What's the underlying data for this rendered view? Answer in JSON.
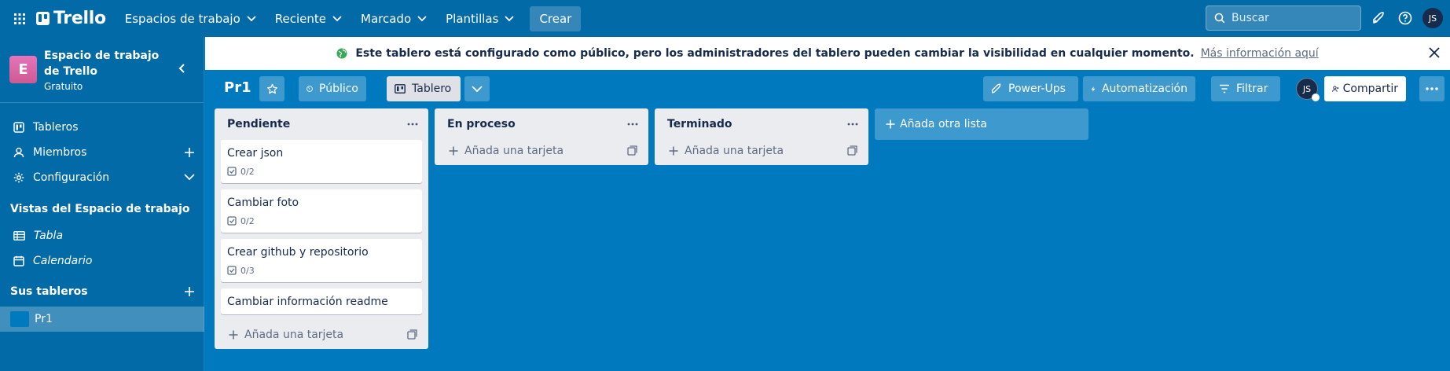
{
  "topnav": {
    "logo": "Trello",
    "menus": [
      {
        "label": "Espacios de trabajo"
      },
      {
        "label": "Reciente"
      },
      {
        "label": "Marcado"
      },
      {
        "label": "Plantillas"
      }
    ],
    "create": "Crear",
    "search_placeholder": "Buscar",
    "user_initials": "JS"
  },
  "sidebar": {
    "workspace_initial": "E",
    "workspace_name": "Espacio de trabajo de Trello",
    "workspace_plan": "Gratuito",
    "items": [
      {
        "label": "Tableros"
      },
      {
        "label": "Miembros"
      },
      {
        "label": "Configuración"
      }
    ],
    "views_title": "Vistas del Espacio de trabajo",
    "views": [
      {
        "label": "Tabla"
      },
      {
        "label": "Calendario"
      }
    ],
    "boards_title": "Sus tableros",
    "boards": [
      {
        "label": "Pr1",
        "color": "#0079bf"
      }
    ]
  },
  "banner": {
    "message": "Este tablero está configurado como público, pero los administradores del tablero pueden cambiar la visibilidad en cualquier momento.",
    "link": "Más información aquí"
  },
  "board": {
    "title": "Pr1",
    "visibility": "Público",
    "view": "Tablero",
    "powerups": "Power-Ups",
    "automation": "Automatización",
    "filter": "Filtrar",
    "member_initials": "JS",
    "share": "Compartir"
  },
  "lists": [
    {
      "title": "Pendiente",
      "cards": [
        {
          "title": "Crear json",
          "checklist": "0/2"
        },
        {
          "title": "Cambiar foto",
          "checklist": "0/2"
        },
        {
          "title": "Crear github y repositorio",
          "checklist": "0/3"
        },
        {
          "title": "Cambiar información readme",
          "checklist": ""
        }
      ],
      "add_card": "Añada una tarjeta"
    },
    {
      "title": "En proceso",
      "cards": [],
      "add_card": "Añada una tarjeta"
    },
    {
      "title": "Terminado",
      "cards": [],
      "add_card": "Añada una tarjeta"
    }
  ],
  "add_list": "Añada otra lista",
  "colors": {
    "board_bg": "#0079bf",
    "header_bg": "#026aa7",
    "list_bg": "#ebecf0",
    "workspace_avatar": "#e774bb"
  }
}
